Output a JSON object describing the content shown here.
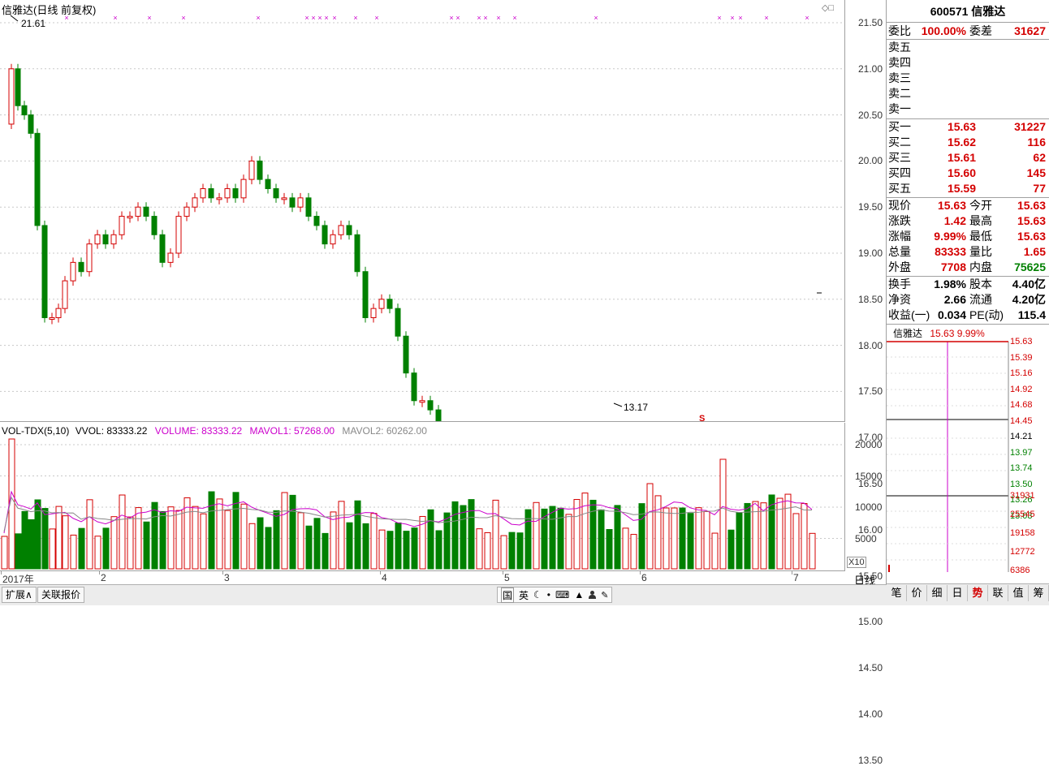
{
  "chart": {
    "title": "信雅达(日线 前复权)",
    "high_label": "21.61",
    "low_label": "13.17",
    "s_marker": "S",
    "price_ticks": [
      "21.50",
      "21.00",
      "20.50",
      "20.00",
      "19.50",
      "19.00",
      "18.50",
      "18.00",
      "17.50",
      "17.00",
      "16.50",
      "16.00",
      "15.50",
      "15.00",
      "14.50",
      "14.00",
      "13.50"
    ]
  },
  "volume": {
    "indicator": "VOL-TDX(5,10)",
    "vvol": "VVOL: 83333.22",
    "volume": "VOLUME: 83333.22",
    "mavol1": "MAVOL1: 57268.00",
    "mavol2": "MAVOL2: 60262.00",
    "ticks": [
      "20000",
      "15000",
      "10000",
      "5000"
    ],
    "x10": "X10"
  },
  "xaxis": {
    "labels": [
      "2017年",
      "2",
      "3",
      "4",
      "5",
      "6",
      "7"
    ],
    "period": "日线"
  },
  "bottom_tabs": [
    "扩展∧",
    "关联报价"
  ],
  "toolbar_icons": [
    "国",
    "英",
    "☾",
    "•",
    "⌨",
    "▲",
    "👤",
    "🔧"
  ],
  "panel": {
    "code": "600571",
    "name": "信雅达",
    "weibi_label": "委比",
    "weibi": "100.00%",
    "weicha_label": "委差",
    "weicha": "31627",
    "sell": [
      {
        "label": "卖五",
        "price": "",
        "vol": ""
      },
      {
        "label": "卖四",
        "price": "",
        "vol": ""
      },
      {
        "label": "卖三",
        "price": "",
        "vol": ""
      },
      {
        "label": "卖二",
        "price": "",
        "vol": ""
      },
      {
        "label": "卖一",
        "price": "",
        "vol": ""
      }
    ],
    "buy": [
      {
        "label": "买一",
        "price": "15.63",
        "vol": "31227"
      },
      {
        "label": "买二",
        "price": "15.62",
        "vol": "116"
      },
      {
        "label": "买三",
        "price": "15.61",
        "vol": "62"
      },
      {
        "label": "买四",
        "price": "15.60",
        "vol": "145"
      },
      {
        "label": "买五",
        "price": "15.59",
        "vol": "77"
      }
    ],
    "quote": [
      {
        "l1": "现价",
        "v1": "15.63",
        "l2": "今开",
        "v2": "15.63"
      },
      {
        "l1": "涨跌",
        "v1": "1.42",
        "l2": "最高",
        "v2": "15.63"
      },
      {
        "l1": "涨幅",
        "v1": "9.99%",
        "l2": "最低",
        "v2": "15.63"
      },
      {
        "l1": "总量",
        "v1": "83333",
        "l2": "量比",
        "v2": "1.65"
      },
      {
        "l1": "外盘",
        "v1": "7708",
        "l2": "内盘",
        "v2": "75625"
      }
    ],
    "fin": [
      {
        "l1": "换手",
        "v1": "1.98%",
        "l2": "股本",
        "v2": "4.40亿"
      },
      {
        "l1": "净资",
        "v1": "2.66",
        "l2": "流通",
        "v2": "4.20亿"
      },
      {
        "l1": "收益(一)",
        "v1": "0.034",
        "l2": "PE(动)",
        "v2": "115.4"
      }
    ],
    "mini_name": "信雅达",
    "mini_price": "15.63",
    "mini_pct": "9.99%",
    "mini_price_ticks": [
      "15.63",
      "15.39",
      "15.16",
      "14.92",
      "14.68",
      "14.45",
      "14.21",
      "13.97",
      "13.74",
      "13.50",
      "13.26",
      "13.03"
    ],
    "mini_vol_ticks": [
      "31931",
      "25545",
      "19158",
      "12772",
      "6386"
    ],
    "tabs": [
      "笔",
      "价",
      "细",
      "日",
      "势",
      "联",
      "值",
      "筹"
    ]
  },
  "colors": {
    "up": "#d40000",
    "down": "#008000",
    "grid": "#c8c8c8",
    "ma1": "#cc00cc",
    "ma2": "#888888"
  }
}
